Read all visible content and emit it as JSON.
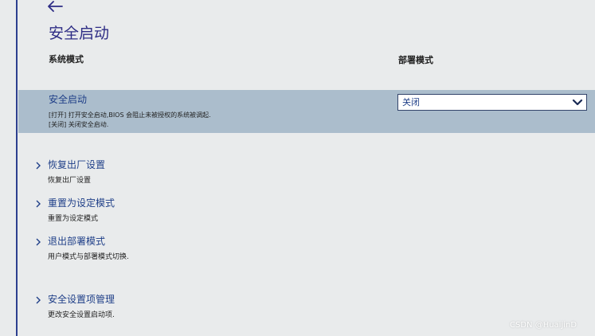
{
  "header": {
    "back_icon": "arrow-left-icon",
    "title": "安全启动"
  },
  "columns": {
    "system_mode_label": "系统模式",
    "deploy_mode_label": "部署模式"
  },
  "secure_boot_setting": {
    "title": "安全启动",
    "desc_line1": "[打开] 打开安全启动,BIOS 会阻止未被授权的系统被调起.",
    "desc_line2": "[关闭] 关闭安全启动.",
    "dropdown_value": "关闭",
    "dropdown_icon": "chevron-down-icon"
  },
  "nav_items": [
    {
      "label": "恢复出厂设置",
      "sub": "恢复出厂设置"
    },
    {
      "label": "重置为设定模式",
      "sub": "重置为设定模式"
    },
    {
      "label": "退出部署模式",
      "sub": "用户模式与部署模式切换."
    },
    {
      "label": "安全设置项管理",
      "sub": "更改安全设置启动项."
    }
  ],
  "watermark": "CSDN @HuaijinD",
  "colors": {
    "background": "#e9ebec",
    "accent": "#2e2d85",
    "highlight": "#abbdcc",
    "link": "#1f3f88"
  }
}
